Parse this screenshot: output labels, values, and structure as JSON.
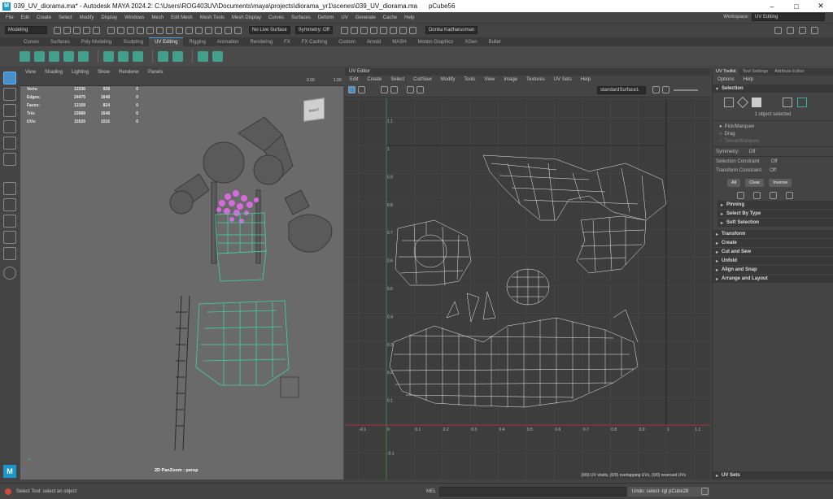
{
  "window": {
    "title": "039_UV_diorama.ma* - Autodesk MAYA 2024.2: C:\\Users\\ROG403UV\\Documents\\maya\\projects\\diorama_yr1\\scenes\\039_UV_diorama.ma",
    "selected_object": "pCube56",
    "logo_letter": "M",
    "minimize": "–",
    "maximize": "□",
    "close": "✕"
  },
  "menubar": {
    "items": [
      "File",
      "Edit",
      "Create",
      "Select",
      "Modify",
      "Display",
      "Windows",
      "Mesh",
      "Edit Mesh",
      "Mesh Tools",
      "Mesh Display",
      "Curves",
      "Surfaces",
      "Deform",
      "UV",
      "Generate",
      "Cache",
      "Help"
    ],
    "workspace_label": "Workspace:",
    "workspace_value": "UV Editing"
  },
  "statusline": {
    "mode": "Modeling",
    "live_surface": "No Live Surface",
    "symmetry": "Symmetry: Off",
    "user": "Donita Kadharusman"
  },
  "shelf": {
    "tabs": [
      "Curves",
      "Surfaces",
      "Poly Modeling",
      "Sculpting",
      "UV Editing",
      "Rigging",
      "Animation",
      "Rendering",
      "FX",
      "FX Caching",
      "Custom",
      "Arnold",
      "MASH",
      "Motion Graphics",
      "XGen",
      "Bullet"
    ],
    "active_tab": "UV Editing"
  },
  "viewport": {
    "menu": [
      "View",
      "Shading",
      "Lighting",
      "Show",
      "Renderer",
      "Panels"
    ],
    "field_value_1": "0.00",
    "field_value_2": "1.00",
    "hud": [
      {
        "label": "Verts:",
        "v1": "12336",
        "v2": "928",
        "v3": "0"
      },
      {
        "label": "Edges:",
        "v1": "24475",
        "v2": "1648",
        "v3": "0"
      },
      {
        "label": "Faces:",
        "v1": "12168",
        "v2": "824",
        "v3": "0"
      },
      {
        "label": "Tris:",
        "v1": "23988",
        "v2": "1648",
        "v3": "0"
      },
      {
        "label": "UVs:",
        "v1": "15526",
        "v2": "1016",
        "v3": "0"
      }
    ],
    "viewcube_label": "RIGHT",
    "camera_label": "2D PanZoom : persp",
    "axis_x": "x",
    "axis_y": "y",
    "axis_z": "z"
  },
  "uv_editor": {
    "title": "UV Editor",
    "menu": [
      "Edit",
      "Create",
      "Select",
      "Cut/Sew",
      "Modify",
      "Tools",
      "View",
      "Image",
      "Textures",
      "UV Sets",
      "Help"
    ],
    "texture_dropdown": "standardSurface1",
    "v_ticks": [
      "1.1",
      "1",
      "0.9",
      "0.8",
      "0.7",
      "0.6",
      "0.5",
      "0.4",
      "0.3",
      "0.2",
      "0.1"
    ],
    "u_ticks": [
      "-0.1",
      "0",
      "0.1",
      "0.2",
      "0.3",
      "0.4",
      "0.5",
      "0.6",
      "0.7",
      "0.8",
      "0.9",
      "1",
      "1.1"
    ],
    "v_neg": "-0.1",
    "status": "(0/9) UV shells, (0/0) overlapping UVs, (0/0) reversed UVs"
  },
  "right_panel": {
    "tabs": [
      "UV Toolkit",
      "Tool Settings",
      "Attribute Editor"
    ],
    "active_tab": "UV Toolkit",
    "submenu": [
      "Options",
      "Help"
    ],
    "selection_header": "Selection",
    "selected_count": "1 object selected",
    "radio": [
      "Pick/Marquee",
      "Drag",
      "Tweak/Marquee"
    ],
    "symmetry_label": "Symmetry:",
    "symmetry_value": "Off",
    "selection_constraint_label": "Selection Constraint",
    "selection_constraint_value": "Off",
    "transform_constraint_label": "Transform Constraint",
    "transform_constraint_value": "Off",
    "buttons": [
      "All",
      "Clear",
      "Inverse"
    ],
    "subsections": [
      "Pinning",
      "Select By Type",
      "Soft Selection"
    ],
    "sections": [
      "Transform",
      "Create",
      "Cut and Sew",
      "Unfold",
      "Align and Snap",
      "Arrange and Layout"
    ],
    "uv_sets": "UV Sets"
  },
  "statusbar": {
    "help_text": "Select Tool: select an object",
    "mel_label": "MEL",
    "result": "Undo: select -tgl pCube28"
  }
}
